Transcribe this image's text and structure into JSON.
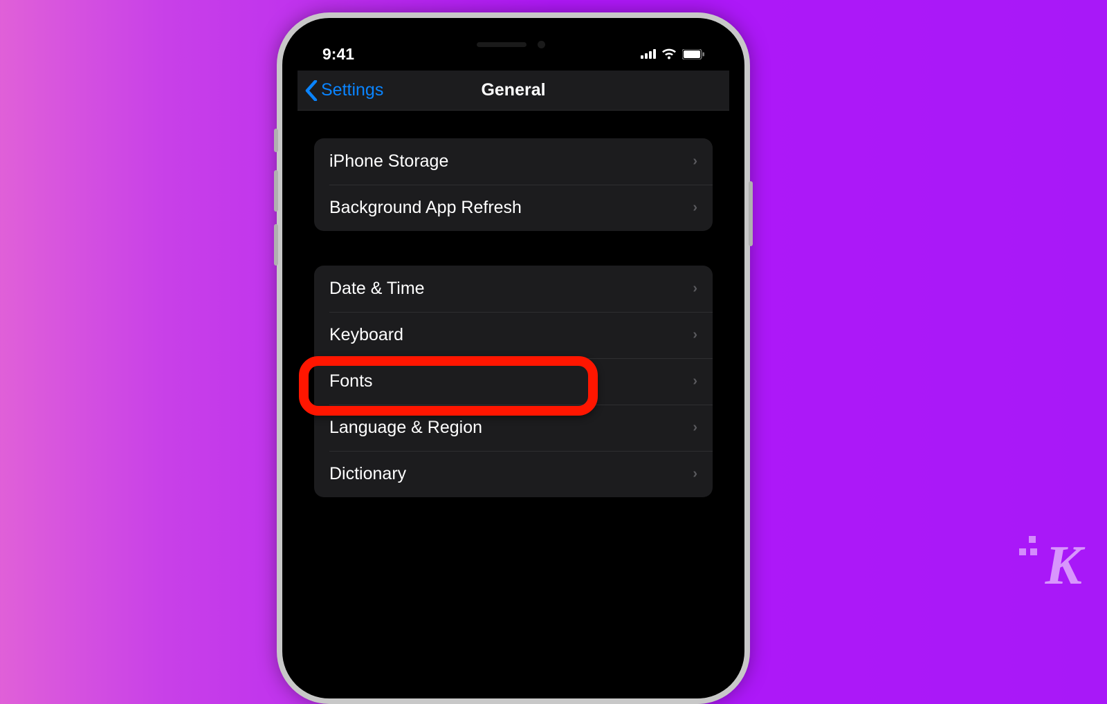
{
  "status": {
    "time": "9:41"
  },
  "nav": {
    "back": "Settings",
    "title": "General"
  },
  "groups": [
    {
      "rows": [
        {
          "label": "iPhone Storage"
        },
        {
          "label": "Background App Refresh"
        }
      ]
    },
    {
      "rows": [
        {
          "label": "Date & Time"
        },
        {
          "label": "Keyboard",
          "highlighted": true
        },
        {
          "label": "Fonts"
        },
        {
          "label": "Language & Region"
        },
        {
          "label": "Dictionary"
        }
      ]
    }
  ],
  "watermark": "K",
  "colors": {
    "accent": "#0a84ff",
    "highlight": "#ff1600"
  }
}
